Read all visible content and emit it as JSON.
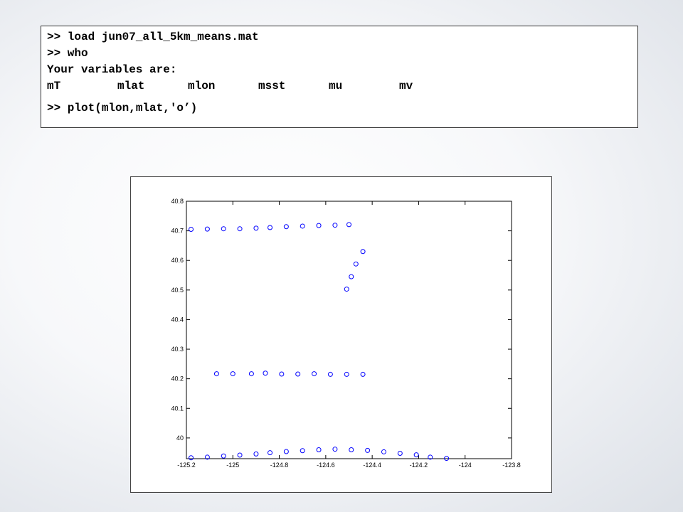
{
  "console": {
    "line1": ">> load jun07_all_5km_means.mat",
    "line2": ">> who",
    "line3": "Your variables are:",
    "variables": [
      "mT",
      "mlat",
      "mlon",
      "msst",
      "mu",
      "mv"
    ],
    "line5": ">> plot(mlon,mlat,'o’)"
  },
  "chart_data": {
    "type": "scatter",
    "title": "",
    "xlabel": "",
    "ylabel": "",
    "xlim": [
      -125.2,
      -123.8
    ],
    "ylim": [
      39.93,
      40.8
    ],
    "x_ticks": [
      -125.2,
      -125,
      -124.8,
      -124.6,
      -124.4,
      -124.2,
      -124,
      -123.8
    ],
    "x_tick_labels": [
      "-125.2",
      "-125",
      "-124.8",
      "-124.6",
      "-124.4",
      "-124.2",
      "-124",
      "-123.8"
    ],
    "y_ticks": [
      40,
      40.1,
      40.2,
      40.3,
      40.4,
      40.5,
      40.6,
      40.7,
      40.8
    ],
    "y_tick_labels": [
      "40",
      "40.1",
      "40.2",
      "40.3",
      "40.4",
      "40.5",
      "40.6",
      "40.7",
      "40.8"
    ],
    "grid": false,
    "marker": "o",
    "marker_color": "#0000ff",
    "series": [
      {
        "points": [
          [
            -125.18,
            40.705
          ],
          [
            -125.11,
            40.706
          ],
          [
            -125.04,
            40.707
          ],
          [
            -124.97,
            40.707
          ],
          [
            -124.9,
            40.709
          ],
          [
            -124.84,
            40.711
          ],
          [
            -124.77,
            40.714
          ],
          [
            -124.7,
            40.716
          ],
          [
            -124.63,
            40.718
          ],
          [
            -124.56,
            40.719
          ],
          [
            -124.5,
            40.721
          ],
          [
            -124.44,
            40.63
          ],
          [
            -124.47,
            40.588
          ],
          [
            -124.49,
            40.545
          ],
          [
            -124.51,
            40.503
          ],
          [
            -125.07,
            40.217
          ],
          [
            -125,
            40.217
          ],
          [
            -124.92,
            40.217
          ],
          [
            -124.86,
            40.219
          ],
          [
            -124.79,
            40.216
          ],
          [
            -124.72,
            40.216
          ],
          [
            -124.65,
            40.217
          ],
          [
            -124.58,
            40.215
          ],
          [
            -124.51,
            40.215
          ],
          [
            -124.44,
            40.215
          ],
          [
            -125.18,
            39.933
          ],
          [
            -125.11,
            39.935
          ],
          [
            -125.04,
            39.939
          ],
          [
            -124.97,
            39.942
          ],
          [
            -124.9,
            39.946
          ],
          [
            -124.84,
            39.95
          ],
          [
            -124.77,
            39.954
          ],
          [
            -124.7,
            39.957
          ],
          [
            -124.63,
            39.96
          ],
          [
            -124.56,
            39.962
          ],
          [
            -124.49,
            39.96
          ],
          [
            -124.42,
            39.958
          ],
          [
            -124.35,
            39.953
          ],
          [
            -124.28,
            39.948
          ],
          [
            -124.21,
            39.943
          ],
          [
            -124.15,
            39.935
          ],
          [
            -124.08,
            39.931
          ]
        ]
      }
    ]
  }
}
